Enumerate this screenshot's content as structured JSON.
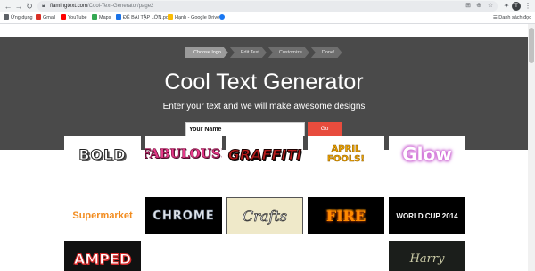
{
  "browser": {
    "url_host": "flamingtext.com",
    "url_path": "/Cool-Text-Generator/page2",
    "bookmarks": [
      {
        "label": "Ứng dụng",
        "color": "#5f6368"
      },
      {
        "label": "Gmail",
        "color": "#d93025"
      },
      {
        "label": "YouTube",
        "color": "#ff0000"
      },
      {
        "label": "Maps",
        "color": "#34a853"
      },
      {
        "label": "ĐỀ BÀI TẬP LỚN.pd...",
        "color": "#1a73e8"
      },
      {
        "label": "Hạnh - Google Drive",
        "color": "#fbbc04"
      },
      {
        "label": "",
        "color": "#1877f2"
      }
    ],
    "reading_list": "Danh sách đọc",
    "avatar_letter": "T"
  },
  "steps": [
    "Choose logo",
    "Edit Text",
    "Customize",
    "Done!"
  ],
  "hero": {
    "title": "Cool Text Generator",
    "subtitle": "Enter your text and we will make awesome designs",
    "input_value": "Your Name",
    "go_label": "Go"
  },
  "gallery": {
    "bold": "BOLD",
    "fabulous": "FABULOUS!",
    "graffiti": "GRAFFITI",
    "april": "APRIL FOOLS!",
    "glow": "Glow",
    "supermarket": "Supermarket",
    "chrome": "CHROME",
    "crafts": "Crafts",
    "fire": "FIRE",
    "worldcup": "WORLD CUP 2014",
    "amped": "AMPED",
    "harry": "Harry"
  }
}
